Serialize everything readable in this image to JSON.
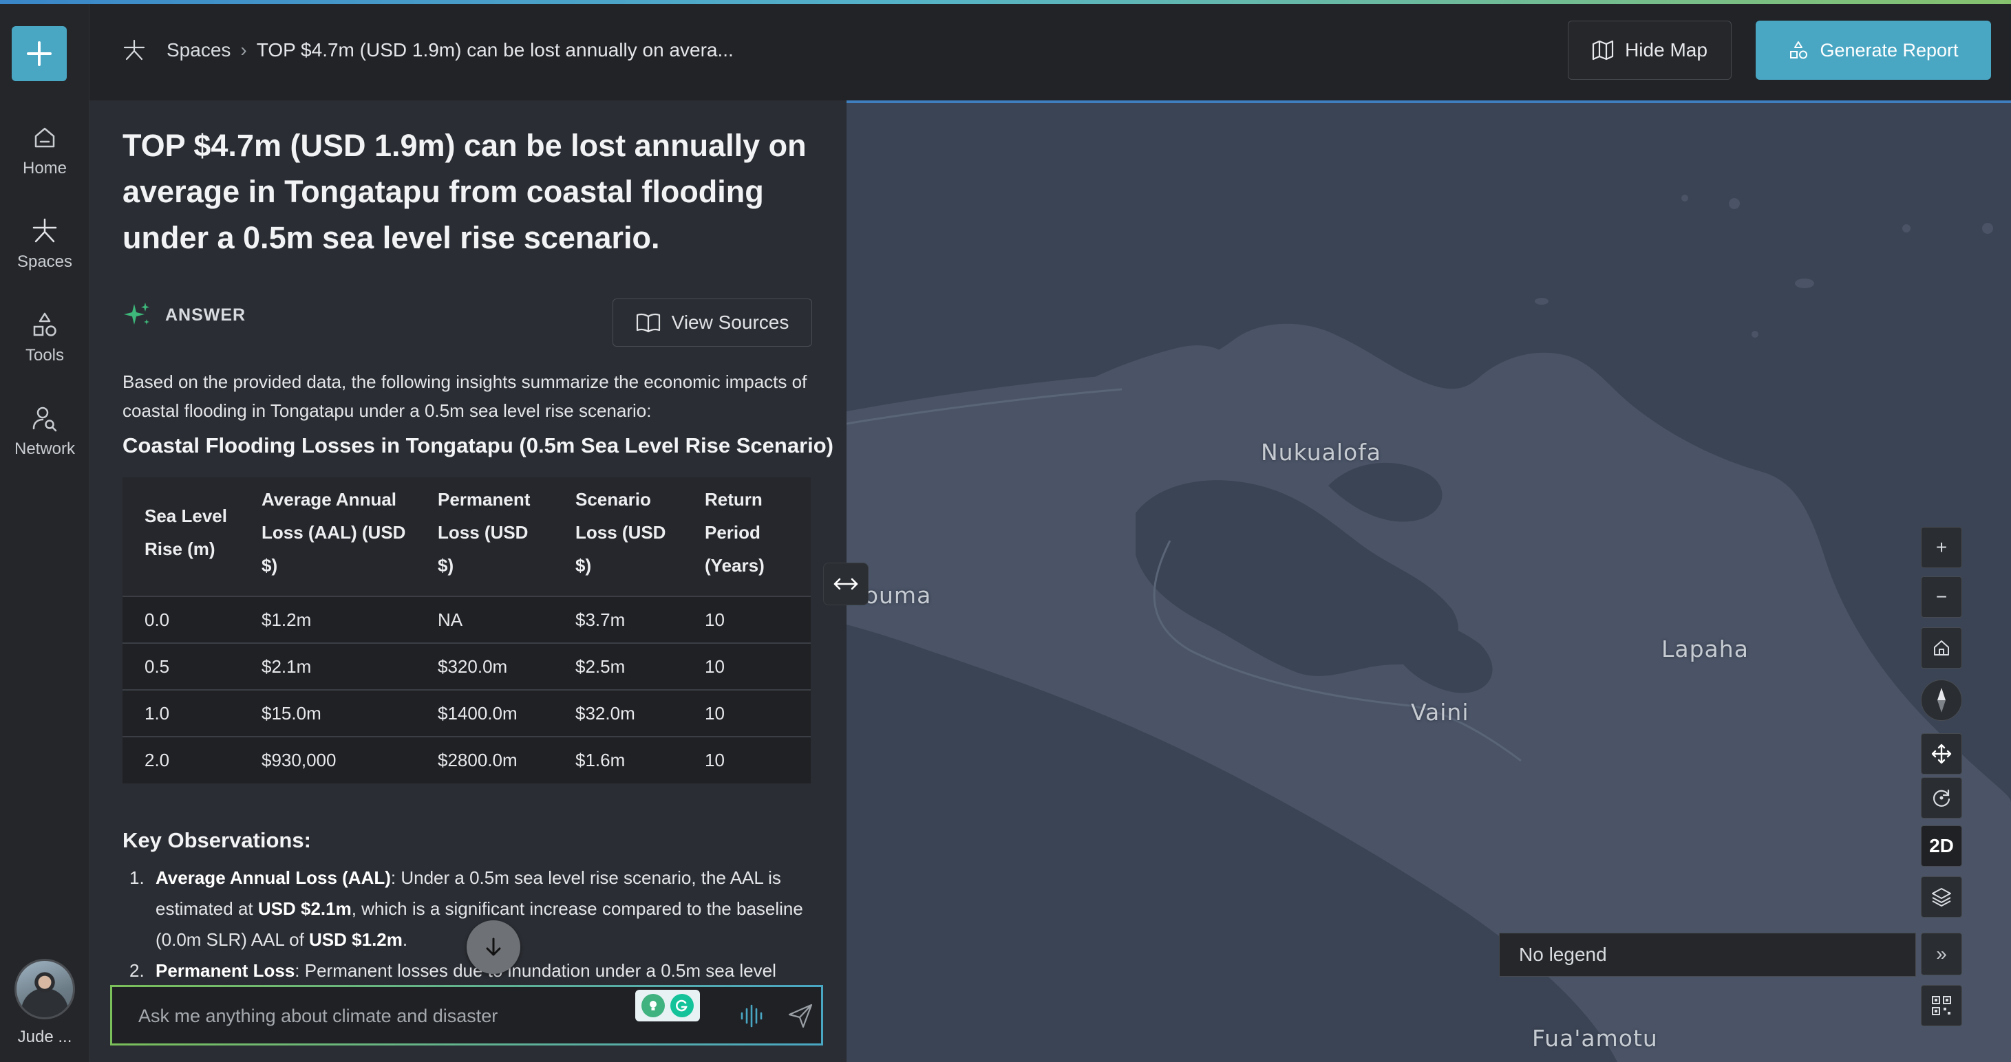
{
  "header": {
    "breadcrumb_root": "Spaces",
    "breadcrumb_sep": "›",
    "breadcrumb_current": "TOP $4.7m (USD 1.9m) can be lost annually on avera...",
    "hide_map_label": "Hide Map",
    "generate_report_label": "Generate Report"
  },
  "sidebar": {
    "new_icon": "plus-icon",
    "items": [
      {
        "label": "Home",
        "icon": "home-icon"
      },
      {
        "label": "Spaces",
        "icon": "asterisk-icon"
      },
      {
        "label": "Tools",
        "icon": "shapes-icon"
      },
      {
        "label": "Network",
        "icon": "user-search-icon"
      }
    ],
    "user_name": "Jude ..."
  },
  "answer": {
    "question_title": "TOP $4.7m (USD 1.9m) can be lost annually on average in Tongatapu from coastal flooding under a 0.5m sea level rise scenario.",
    "answer_label": "ANSWER",
    "view_sources_label": "View Sources",
    "intro": "Based on the provided data, the following insights summarize the economic impacts of coastal flooding in Tongatapu under a 0.5m sea level rise scenario:",
    "table_title": "Coastal Flooding Losses in Tongatapu (0.5m Sea Level Rise Scenario)",
    "table": {
      "headers": [
        "Sea Level Rise (m)",
        "Average Annual Loss (AAL) (USD $)",
        "Permanent Loss (USD $)",
        "Scenario Loss (USD $)",
        "Return Period (Years)"
      ],
      "rows": [
        [
          "0.0",
          "$1.2m",
          "NA",
          "$3.7m",
          "10"
        ],
        [
          "0.5",
          "$2.1m",
          "$320.0m",
          "$2.5m",
          "10"
        ],
        [
          "1.0",
          "$15.0m",
          "$1400.0m",
          "$32.0m",
          "10"
        ],
        [
          "2.0",
          "$930,000",
          "$2800.0m",
          "$1.6m",
          "10"
        ]
      ]
    },
    "observations_title": "Key Observations:",
    "observations": [
      {
        "num": "1.",
        "bold": "Average Annual Loss (AAL)",
        "text_a": ": Under a 0.5m sea level rise scenario, the AAL is estimated at ",
        "bold_b": "USD $2.1m",
        "text_b": ", which is a significant increase compared to the baseline (0.0m SLR) AAL of ",
        "bold_c": "USD $1.2m",
        "text_c": "."
      },
      {
        "num": "2.",
        "bold": "Permanent Loss",
        "text_a": ": Permanent losses due to inundation under a 0.5m sea level"
      }
    ]
  },
  "chat": {
    "placeholder": "Ask me anything about climate and disaster"
  },
  "map": {
    "places": [
      "Nukualofa",
      "Houma",
      "Lapaha",
      "Vaini",
      "Fua'amotu"
    ],
    "controls": {
      "zoom_in": "+",
      "zoom_out": "−",
      "mode_2d": "2D"
    },
    "legend_text": "No legend",
    "legend_toggle": "»"
  }
}
